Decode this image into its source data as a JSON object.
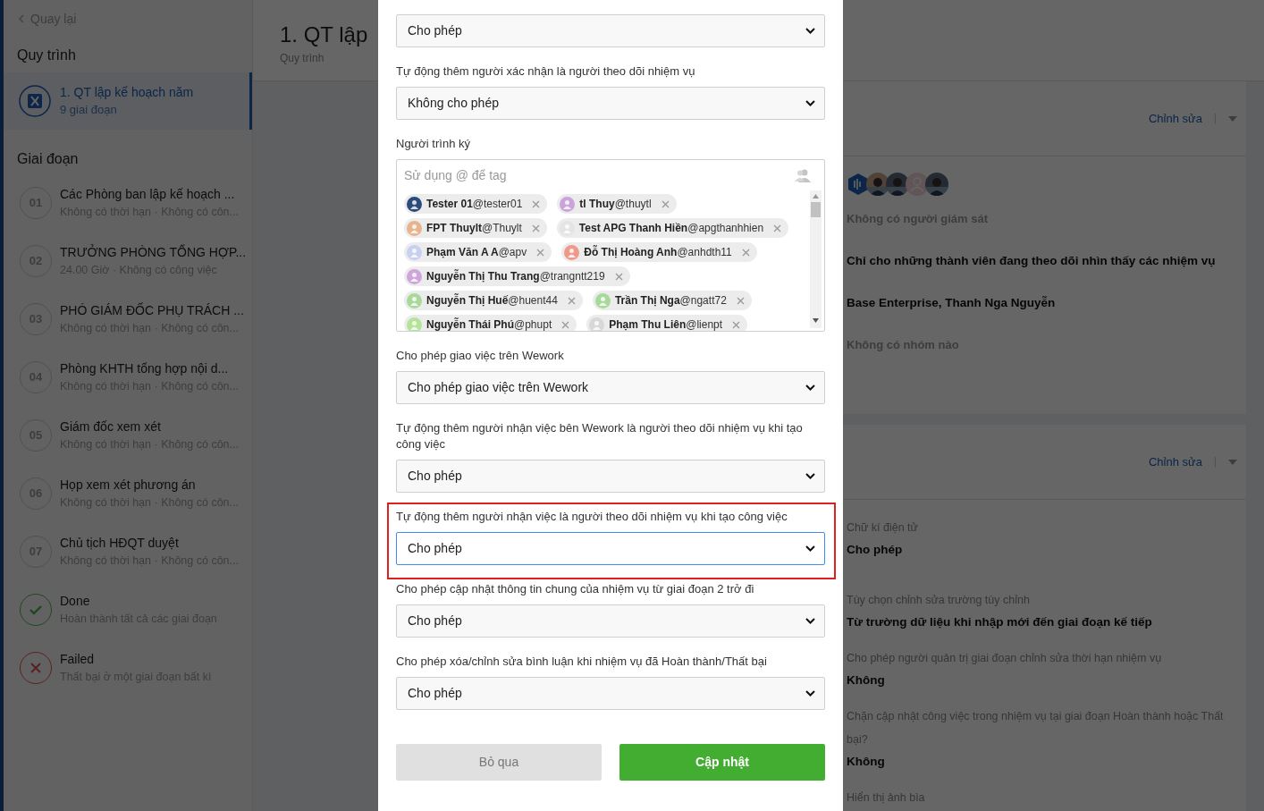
{
  "sidebar": {
    "back": "Quay lại",
    "process_heading": "Quy trình",
    "process": {
      "title": "1. QT lập kế hoạch năm",
      "subtitle": "9 giai đoạn",
      "selected": true
    },
    "stages_heading": "Giai đoạn",
    "stages": [
      {
        "kind": "number",
        "badge": "01",
        "title": "Các Phòng ban lập kế hoạch ...",
        "subtitle": "Không có thời hạn · Không có côn..."
      },
      {
        "kind": "number",
        "badge": "02",
        "title": "TRƯỞNG PHÒNG TỔNG HỢP...",
        "subtitle": "24.00 Giờ · Không có công việc"
      },
      {
        "kind": "number",
        "badge": "03",
        "title": "PHÓ GIÁM ĐỐC PHỤ TRÁCH ...",
        "subtitle": "Không có thời hạn · Không có côn..."
      },
      {
        "kind": "number",
        "badge": "04",
        "title": "Phòng KHTH tổng hợp nội d...",
        "subtitle": "Không có thời hạn · Không có côn..."
      },
      {
        "kind": "number",
        "badge": "05",
        "title": "Giám đốc xem xét",
        "subtitle": "Không có thời hạn · Không có côn..."
      },
      {
        "kind": "number",
        "badge": "06",
        "title": "Họp xem xét phương án",
        "subtitle": "Không có thời hạn · Không có côn..."
      },
      {
        "kind": "number",
        "badge": "07",
        "title": "Chủ tịch HĐQT duyệt",
        "subtitle": "Không có thời hạn · Không có côn..."
      },
      {
        "kind": "done",
        "title": "Done",
        "subtitle": "Hoàn thành tất cả các giai đoạn"
      },
      {
        "kind": "failed",
        "title": "Failed",
        "subtitle": "Thất bại ở một giai đoạn bất kì"
      }
    ]
  },
  "header": {
    "title": "1. QT lập",
    "subtitle": "Quy trình"
  },
  "panels": [
    {
      "edit": "Chỉnh sửa",
      "members": [
        {
          "kind": "logo"
        },
        {
          "kind": "picture"
        },
        {
          "kind": "picture"
        },
        {
          "kind": "placeholder"
        },
        {
          "kind": "picture"
        }
      ],
      "rows": [
        {
          "kind": "muted",
          "text": "Không có người giám sát"
        },
        {
          "kind": "value",
          "text": "Chỉ cho những thành viên đang theo dõi nhìn thấy các nhiệm vụ"
        },
        {
          "kind": "value",
          "text": "Base Enterprise, Thanh Nga Nguyễn"
        },
        {
          "kind": "muted",
          "text": "Không có nhóm nào"
        }
      ]
    },
    {
      "edit": "Chỉnh sửa",
      "rows": [
        {
          "kind": "label",
          "text": "Chữ kí điện tử"
        },
        {
          "kind": "value",
          "text": "Cho phép"
        },
        {
          "kind": "label",
          "text": "Tùy chọn chỉnh sửa trường tùy chỉnh"
        },
        {
          "kind": "value",
          "text": "Từ trường dữ liệu khi nhập mới đến giai đoạn kế tiếp"
        },
        {
          "kind": "label",
          "text": "Cho phép người quản trị giai đoạn chỉnh sửa thời hạn nhiệm vụ"
        },
        {
          "kind": "value",
          "text": "Không"
        },
        {
          "kind": "label",
          "text": "Chặn cập nhật công việc trong nhiệm vụ tại giai đoạn Hoàn thành hoặc Thất bại?"
        },
        {
          "kind": "value",
          "text": "Không"
        },
        {
          "kind": "label",
          "text": "Hiển thị ảnh bìa"
        }
      ]
    }
  ],
  "modal": {
    "fields": [
      {
        "kind": "select",
        "value": "Cho phép",
        "highlighted": false,
        "focused": false
      },
      {
        "kind": "select",
        "label": "Tự động thêm người xác nhận là người theo dõi nhiệm vụ",
        "value": "Không cho phép",
        "highlighted": false,
        "focused": false
      },
      {
        "kind": "tags",
        "label": "Người trình ký",
        "placeholder": "Sử dụng @ để tag",
        "tags": [
          {
            "name": "Tester 01",
            "handle": "@tester01",
            "color": "#2c4a7a"
          },
          {
            "name": "tl Thuy",
            "handle": "@thuytl",
            "color": "#c9a3d9"
          },
          {
            "name": "FPT Thuylt",
            "handle": "@Thuylt",
            "color": "#e8b48f"
          },
          {
            "name": "Test APG Thanh Hiền",
            "handle": "@apgthanhhien",
            "color": "#e4e4e4"
          },
          {
            "name": "Phạm Văn A A",
            "handle": "@apv",
            "color": "#c8d0f0"
          },
          {
            "name": "Đỗ Thị Hoàng Anh",
            "handle": "@anhdth11",
            "color": "#f0998a"
          },
          {
            "name": "Nguyễn Thị Thu Trang",
            "handle": "@trangntt219",
            "color": "#cfa6dc"
          },
          {
            "name": "Nguyễn Thị Huế",
            "handle": "@huent44",
            "color": "#a9d99a"
          },
          {
            "name": "Trần Thị Nga",
            "handle": "@ngatt72",
            "color": "#a9d99a"
          },
          {
            "name": "Nguyễn Thái Phú",
            "handle": "@phupt",
            "color": "#b6e39a"
          },
          {
            "name": "Phạm Thu Liên",
            "handle": "@lienpt",
            "color": "#d8d8d8"
          }
        ]
      },
      {
        "kind": "select",
        "label": "Cho phép giao việc trên Wework",
        "value": "Cho phép giao việc trên Wework",
        "highlighted": false,
        "focused": false
      },
      {
        "kind": "select",
        "label": "Tự động thêm người nhận việc bên Wework là người theo dõi nhiệm vụ khi tạo công việc",
        "value": "Cho phép",
        "highlighted": false,
        "focused": false
      },
      {
        "kind": "select",
        "label": "Tự động thêm người nhận việc là người theo dõi nhiệm vụ khi tạo công việc",
        "value": "Cho phép",
        "highlighted": true,
        "focused": true
      },
      {
        "kind": "select",
        "label": "Cho phép cập nhật thông tin chung của nhiệm vụ từ giai đoạn 2 trở đi",
        "value": "Cho phép",
        "highlighted": false,
        "focused": false
      },
      {
        "kind": "select",
        "label": "Cho phép xóa/chỉnh sửa bình luận khi nhiệm vụ đã Hoàn thành/Thất bại",
        "value": "Cho phép",
        "highlighted": false,
        "focused": false
      }
    ],
    "cancel": "Bỏ qua",
    "submit": "Cập nhật"
  }
}
